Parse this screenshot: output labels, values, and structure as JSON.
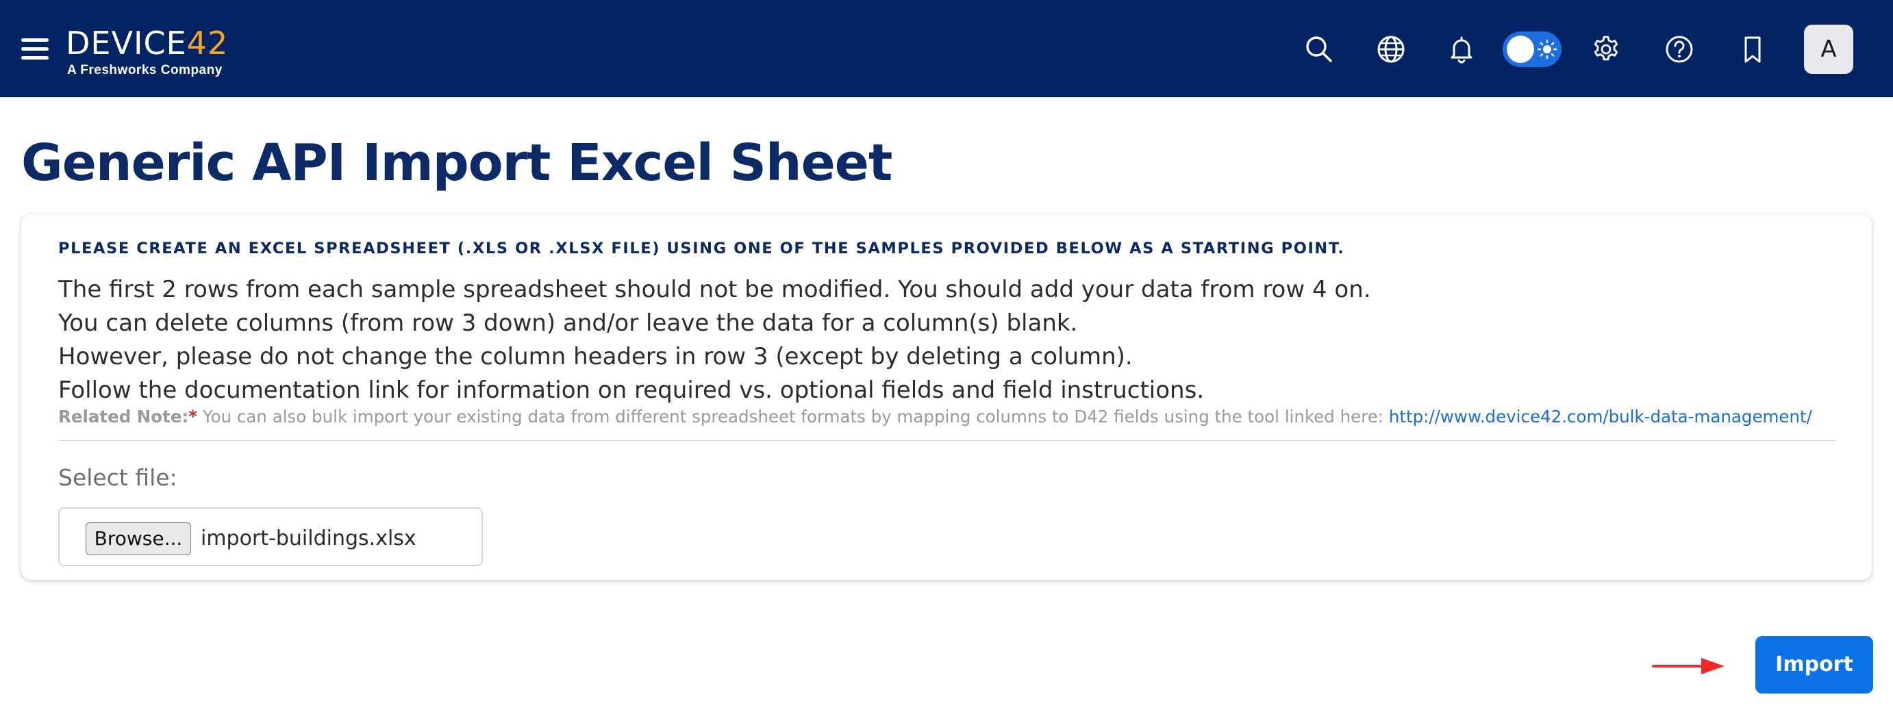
{
  "header": {
    "brand_word": "DEVICE",
    "brand_number": "42",
    "brand_tagline": "A Freshworks Company",
    "avatar_initial": "A",
    "icons": [
      "menu-icon",
      "search-icon",
      "globe-icon",
      "bell-icon",
      "theme-toggle",
      "gear-icon",
      "help-icon",
      "bookmark-icon"
    ],
    "colors": {
      "background": "#022465",
      "brand_accent": "#f5a623",
      "toggle": "#1b6fe0"
    }
  },
  "page": {
    "title": "Generic API Import Excel Sheet"
  },
  "card": {
    "heading": "PLEASE CREATE AN EXCEL SPREADSHEET (.XLS OR .XLSX FILE) USING ONE OF THE SAMPLES PROVIDED BELOW AS A STARTING POINT.",
    "instructions": [
      "The first 2 rows from each sample spreadsheet should not be modified. You should add your data from row 4 on.",
      "You can delete columns (from row 3 down) and/or leave the data for a column(s) blank.",
      "However, please do not change the column headers in row 3 (except by deleting a column).",
      "Follow the documentation link for information on required vs. optional fields and field instructions."
    ],
    "related_note": {
      "label": "Related Note:",
      "asterisk": "*",
      "text": " You can also bulk import your existing data from different spreadsheet formats by mapping columns to D42 fields using the tool linked here: ",
      "link_text": "http://www.device42.com/bulk-data-management/"
    },
    "select_file_label": "Select file:",
    "file_input": {
      "browse_label": "Browse...",
      "selected_file": "import-buildings.xlsx"
    }
  },
  "actions": {
    "import_label": "Import",
    "import_color": "#0a72e6",
    "annotation_arrow_color": "#ee2b2b"
  }
}
